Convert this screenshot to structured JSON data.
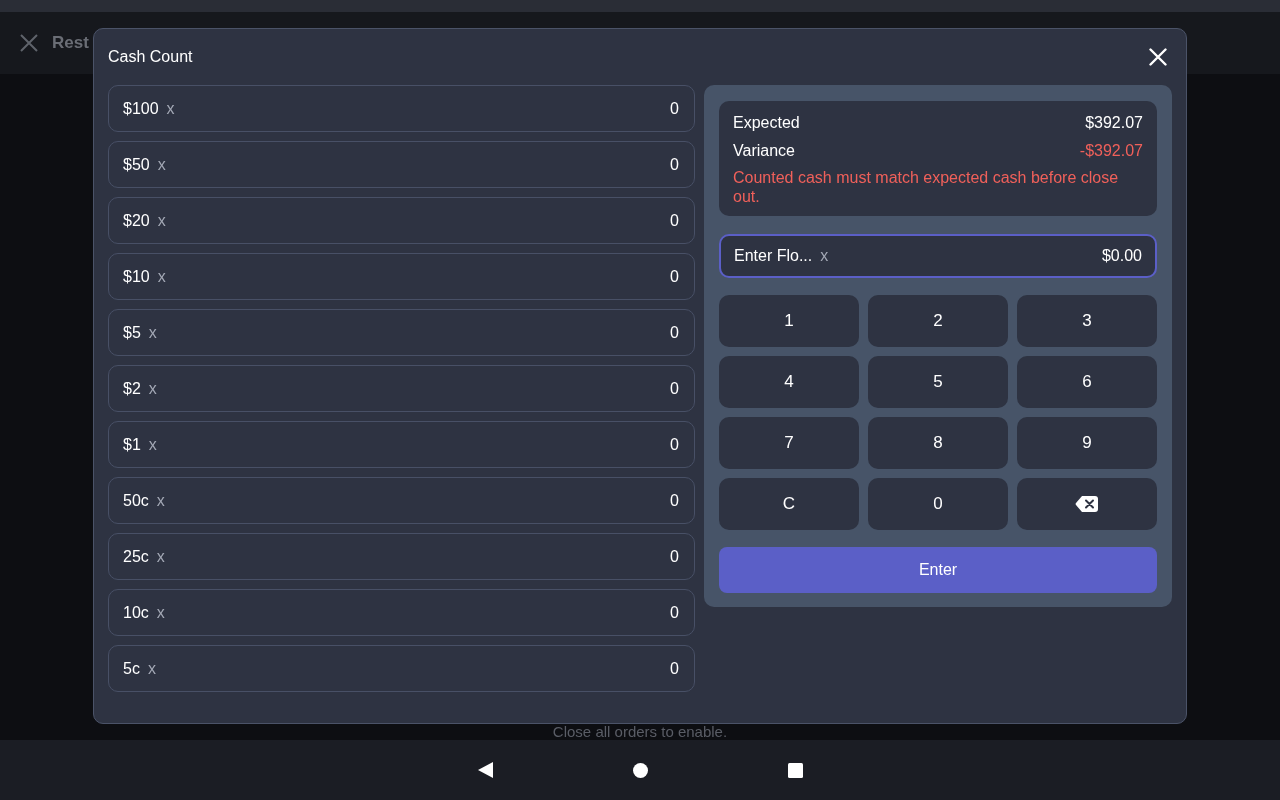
{
  "app_header": {
    "title": "Rest"
  },
  "background_note": "Close all orders to enable.",
  "dialog": {
    "title": "Cash Count",
    "denominations": [
      {
        "label": "$100",
        "multiplier": "x",
        "count": "0"
      },
      {
        "label": "$50",
        "multiplier": "x",
        "count": "0"
      },
      {
        "label": "$20",
        "multiplier": "x",
        "count": "0"
      },
      {
        "label": "$10",
        "multiplier": "x",
        "count": "0"
      },
      {
        "label": "$5",
        "multiplier": "x",
        "count": "0"
      },
      {
        "label": "$2",
        "multiplier": "x",
        "count": "0"
      },
      {
        "label": "$1",
        "multiplier": "x",
        "count": "0"
      },
      {
        "label": "50c",
        "multiplier": "x",
        "count": "0"
      },
      {
        "label": "25c",
        "multiplier": "x",
        "count": "0"
      },
      {
        "label": "10c",
        "multiplier": "x",
        "count": "0"
      },
      {
        "label": "5c",
        "multiplier": "x",
        "count": "0"
      }
    ],
    "summary": {
      "rows": [
        {
          "label": "Expected",
          "value": "$392.07",
          "kind": "normal"
        },
        {
          "label": "Variance",
          "value": "-$392.07",
          "kind": "negative"
        }
      ],
      "warning": "Counted cash must match expected cash before close out."
    },
    "float_field": {
      "label": "Enter Flo...",
      "multiplier": "x",
      "value": "$0.00",
      "focused": true
    },
    "keypad": [
      {
        "kind": "text",
        "label": "1"
      },
      {
        "kind": "text",
        "label": "2"
      },
      {
        "kind": "text",
        "label": "3"
      },
      {
        "kind": "text",
        "label": "4"
      },
      {
        "kind": "text",
        "label": "5"
      },
      {
        "kind": "text",
        "label": "6"
      },
      {
        "kind": "text",
        "label": "7"
      },
      {
        "kind": "text",
        "label": "8"
      },
      {
        "kind": "text",
        "label": "9"
      },
      {
        "kind": "text",
        "label": "C"
      },
      {
        "kind": "text",
        "label": "0"
      },
      {
        "kind": "backspace"
      }
    ],
    "enter_button": {
      "label": "Enter"
    }
  }
}
